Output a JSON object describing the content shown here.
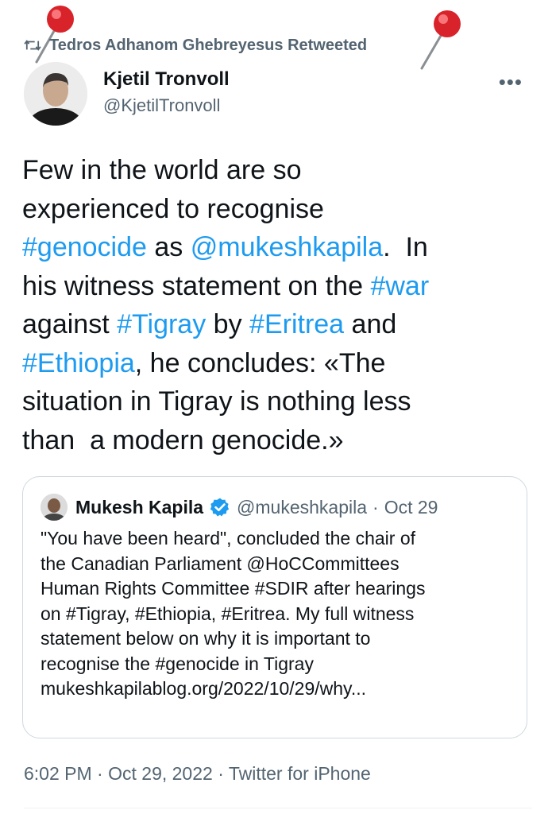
{
  "retweet": {
    "label": "Tedros Adhanom Ghebreyesus Retweeted",
    "icon": "retweet-icon"
  },
  "pins": [
    "pushpin-icon",
    "pushpin-icon"
  ],
  "author": {
    "name": "Kjetil Tronvoll",
    "handle": "@KjetilTronvoll",
    "more_label": "•••"
  },
  "tweet": {
    "lines": [
      [
        {
          "t": "Few in the world are so",
          "l": false
        }
      ],
      [
        {
          "t": "experienced to recognise",
          "l": false
        }
      ],
      [
        {
          "t": "#genocide",
          "l": true
        },
        {
          "t": " as ",
          "l": false
        },
        {
          "t": "@mukeshkapila",
          "l": true
        },
        {
          "t": ".  In",
          "l": false
        }
      ],
      [
        {
          "t": "his witness statement on the ",
          "l": false
        },
        {
          "t": "#war",
          "l": true
        }
      ],
      [
        {
          "t": "against ",
          "l": false
        },
        {
          "t": "#Tigray",
          "l": true
        },
        {
          "t": " by ",
          "l": false
        },
        {
          "t": "#Eritrea",
          "l": true
        },
        {
          "t": " and",
          "l": false
        }
      ],
      [
        {
          "t": "#Ethiopia",
          "l": true
        },
        {
          "t": ", he concludes: «The",
          "l": false
        }
      ],
      [
        {
          "t": "situation in Tigray is nothing less",
          "l": false
        }
      ],
      [
        {
          "t": "than  a modern genocide.»",
          "l": false
        }
      ]
    ]
  },
  "quote": {
    "name": "Mukesh Kapila",
    "handle": "@mukeshkapila",
    "separator": "·",
    "date": "Oct 29",
    "lines": [
      "\"You have been heard\", concluded the chair of",
      "the Canadian Parliament @HoCCommittees",
      "Human Rights Committee #SDIR after hearings",
      "on #Tigray, #Ethiopia, #Eritrea. My full witness",
      "statement below on why it is important to",
      "recognise the #genocide in Tigray",
      "mukeshkapilablog.org/2022/10/29/why..."
    ]
  },
  "meta": {
    "time": "6:02 PM",
    "sep1": "·",
    "date": "Oct 29, 2022",
    "sep2": "·",
    "source": "Twitter for iPhone"
  },
  "colors": {
    "link": "#1d9bf0",
    "secondary": "#536471",
    "text": "#0f1419",
    "pin": "#e0262c"
  }
}
